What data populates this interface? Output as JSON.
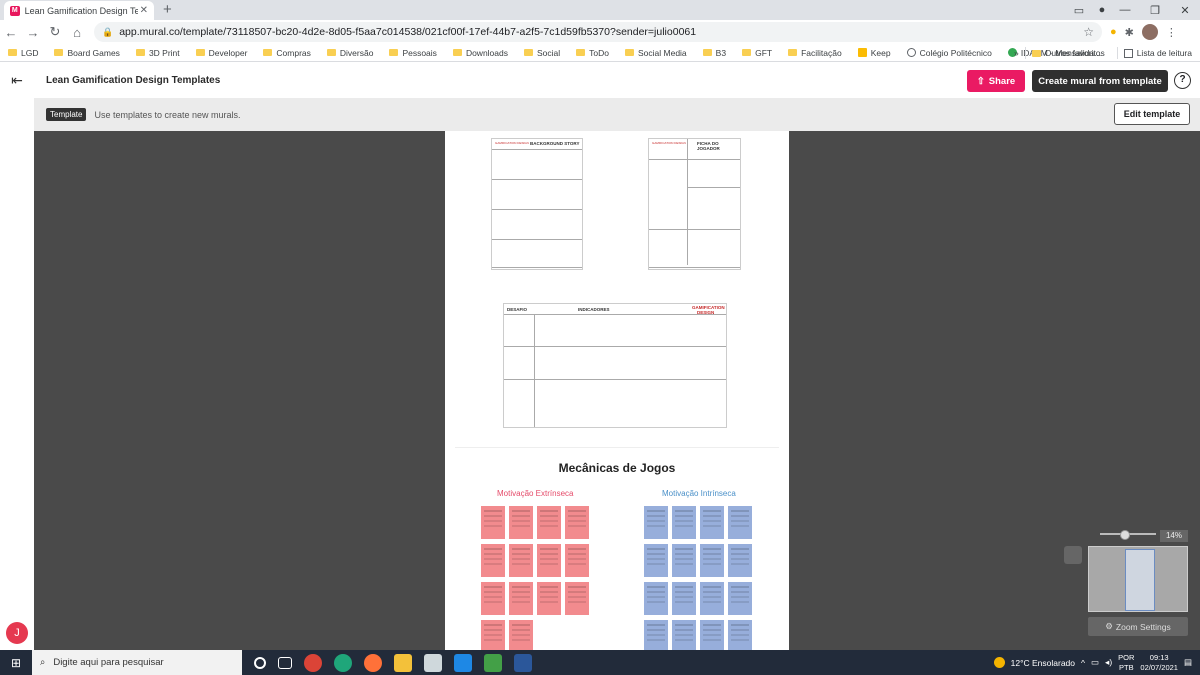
{
  "browser": {
    "tab_title": "Lean Gamification Design Templa",
    "url": "app.mural.co/template/73118507-bc20-4d2e-8d05-f5aa7c014538/021cf00f-17ef-44b7-a2f5-7c1d59fb5370?sender=julio0061",
    "bookmarks": [
      "LGD",
      "Board Games",
      "3D Print",
      "Developer",
      "Compras",
      "Diversão",
      "Pessoais",
      "Downloads",
      "Social",
      "ToDo",
      "Social Media",
      "B3",
      "GFT",
      "Facilitação"
    ],
    "bookmark_keep": "Keep",
    "bookmark_colegio": "Colégio Politécnico",
    "bookmark_idaam": "IDAAM - Mensalida...",
    "bookmark_more": "»",
    "other_favorites": "Outros favoritos",
    "reading_list": "Lista de leitura"
  },
  "mural": {
    "title": "Lean Gamification Design Templates",
    "share_label": "Share",
    "create_label": "Create mural from template",
    "help": "?",
    "badge": "Template",
    "banner_text": "Use templates to create new murals.",
    "edit_label": "Edit template",
    "user_initial": "J"
  },
  "content": {
    "background_story": "BACKGROUND STORY",
    "ficha": "FICHA DO JOGADOR",
    "logo_small": "GAMIFICATION DESIGN",
    "desafio": "DESAFIO",
    "indicadores": "INDICADORES",
    "logo_big_1": "GAMIFICATION",
    "logo_big_2": "DESIGN",
    "section_title": "Mecânicas de Jogos",
    "motivacao_ext": "Motivação Extrínseca",
    "motivacao_int": "Motivação Intrínseca"
  },
  "zoom": {
    "percent": "14%",
    "settings_label": "Zoom Settings"
  },
  "taskbar": {
    "search_placeholder": "Digite aqui para pesquisar",
    "weather": "12°C  Ensolarado",
    "lang_1": "POR",
    "lang_2": "PTB",
    "time": "09:13",
    "date": "02/07/2021"
  }
}
